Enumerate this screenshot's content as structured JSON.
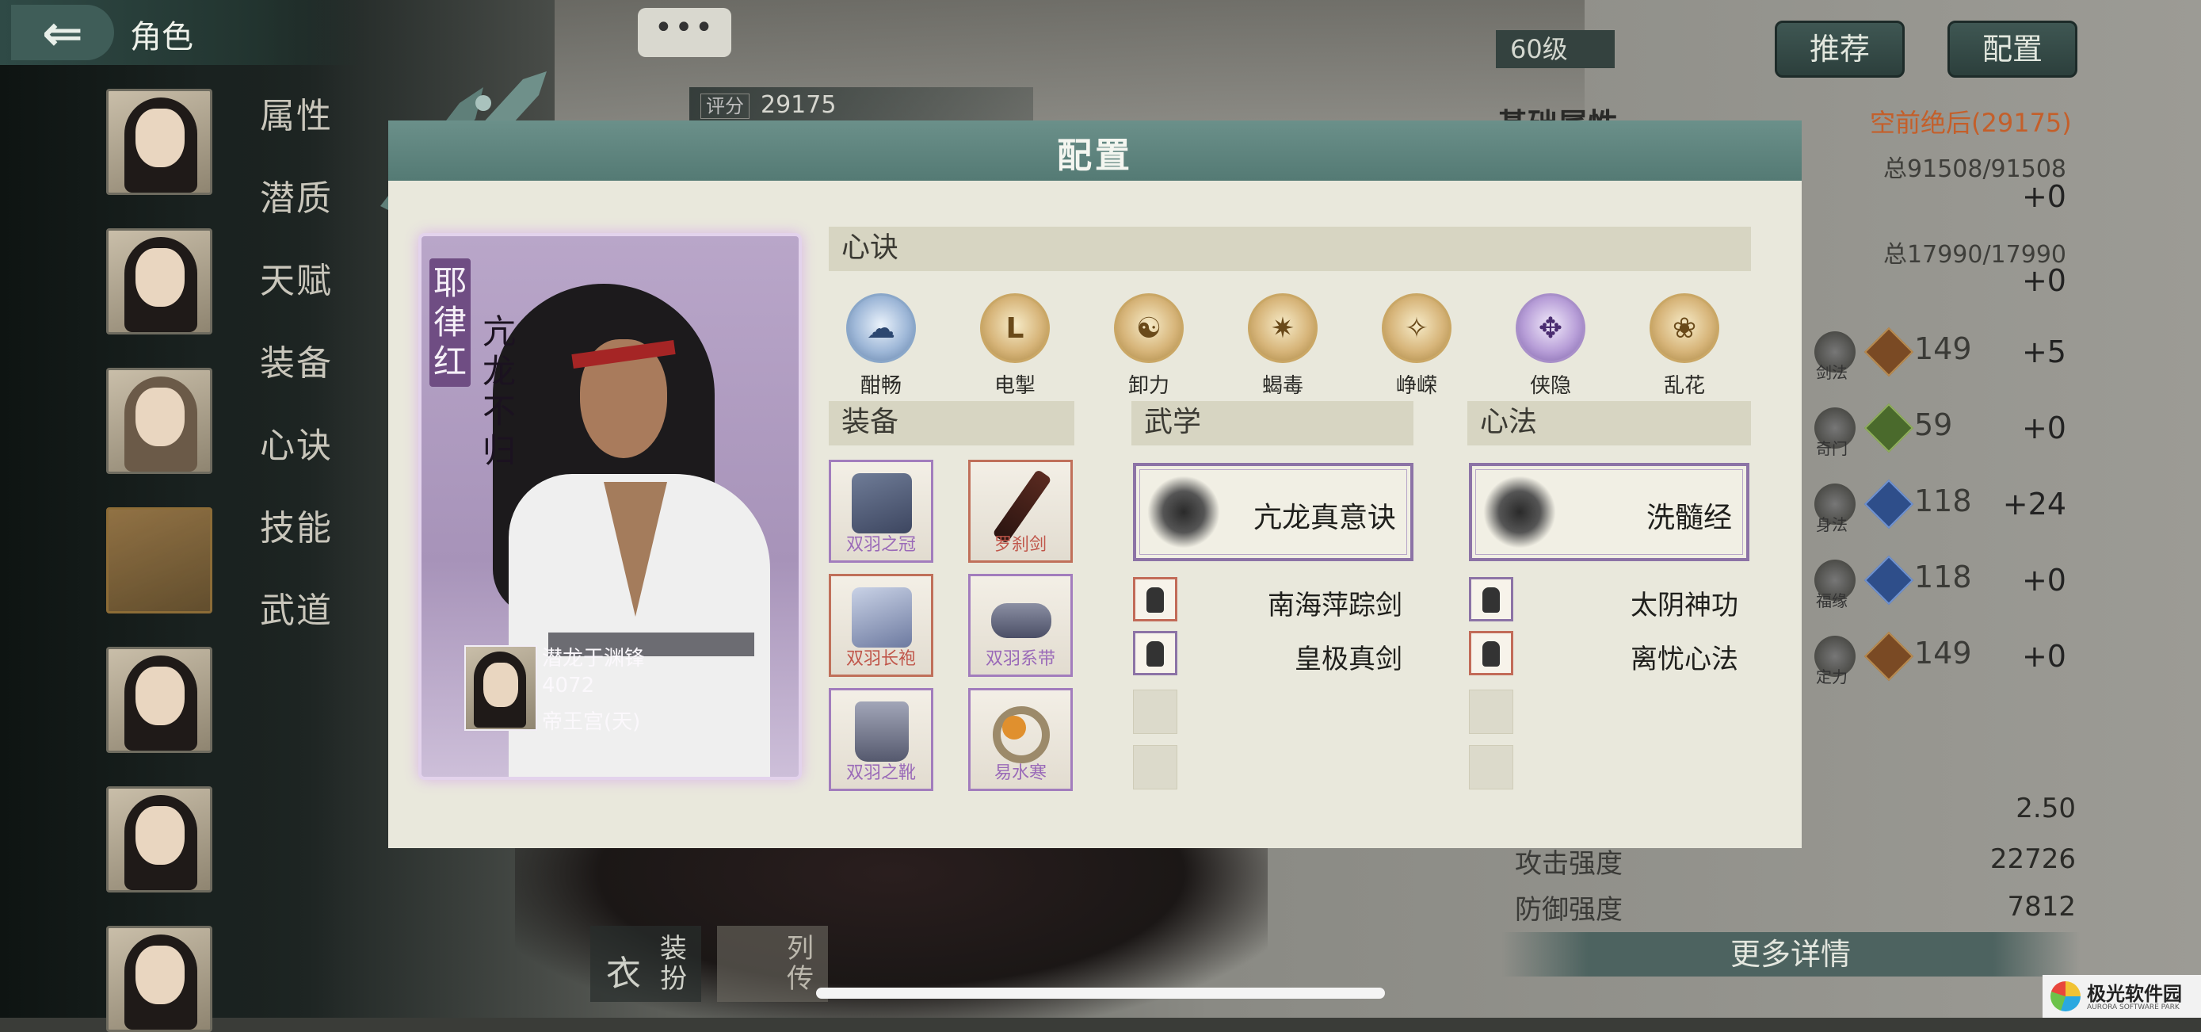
{
  "topbar": {
    "back_icon": "arrow-left-icon",
    "title": "角色",
    "chat_label": "•••"
  },
  "score": {
    "label": "评分",
    "value": "29175"
  },
  "sidebar": {
    "menu": [
      "属性",
      "潜质",
      "天赋",
      "装备",
      "心诀",
      "技能",
      "武道"
    ]
  },
  "header": {
    "level": "60级",
    "recommend": "推荐",
    "config": "配置"
  },
  "attributes": {
    "title": "基础属性",
    "rating": "空前绝后(29175)",
    "hp": "总91508/91508",
    "hp_plus": "+0",
    "mp": "总17990/17990",
    "mp_plus": "+0",
    "skills": [
      {
        "tag": "剑法",
        "value": "149",
        "plus": "+5"
      },
      {
        "tag": "奇门",
        "value": "59",
        "plus": "+0"
      },
      {
        "tag": "身法",
        "value": "118",
        "plus": "+24"
      },
      {
        "tag": "福缘",
        "value": "118",
        "plus": "+0"
      },
      {
        "tag": "定力",
        "value": "149",
        "plus": "+0"
      }
    ],
    "lower": [
      {
        "label": "",
        "value": "2.50"
      },
      {
        "label": "攻击强度",
        "value": "22726"
      },
      {
        "label": "防御强度",
        "value": "7812"
      }
    ],
    "details": "更多详情"
  },
  "dialog": {
    "title": "配置",
    "hero": {
      "name": "耶律红",
      "title": "亢龙不归",
      "mini": {
        "line1": "潜龙于渊锋",
        "line2": "4072",
        "line3": "帝王宫(天)"
      }
    },
    "xinjue_header": "心诀",
    "xinjue": [
      {
        "name": "酣畅",
        "glyph": "☁",
        "style": "blue"
      },
      {
        "name": "电掣",
        "glyph": "L",
        "style": "gold"
      },
      {
        "name": "卸力",
        "glyph": "☯",
        "style": "gold"
      },
      {
        "name": "蝎毒",
        "glyph": "✷",
        "style": "gold"
      },
      {
        "name": "峥嵘",
        "glyph": "✧",
        "style": "gold"
      },
      {
        "name": "侠隐",
        "glyph": "✥",
        "style": "purple"
      },
      {
        "name": "乱花",
        "glyph": "❀",
        "style": "gold"
      }
    ],
    "equip_header": "装备",
    "equip": [
      {
        "name": "双羽之冠",
        "variant": "purple",
        "icon": "crown-icon"
      },
      {
        "name": "罗刹剑",
        "variant": "red",
        "icon": "sword-icon"
      },
      {
        "name": "双羽长袍",
        "variant": "red",
        "icon": "robe-icon"
      },
      {
        "name": "双羽系带",
        "variant": "purple",
        "icon": "belt-icon"
      },
      {
        "name": "双羽之靴",
        "variant": "purple",
        "icon": "boots-icon"
      },
      {
        "name": "易水寒",
        "variant": "purple",
        "icon": "ring-icon"
      }
    ],
    "wuxue_header": "武学",
    "wuxue_main": "亢龙真意诀",
    "wuxue_list": [
      "南海萍踪剑",
      "皇极真剑"
    ],
    "xinfa_header": "心法",
    "xinfa_main": "洗髓经",
    "xinfa_list": [
      "太阴神功",
      "离忧心法"
    ]
  },
  "bottom": {
    "dress": "装扮",
    "bio": "列传"
  },
  "watermark": {
    "title": "极光软件园",
    "subtitle": "AURORA SOFTWARE PARK"
  }
}
